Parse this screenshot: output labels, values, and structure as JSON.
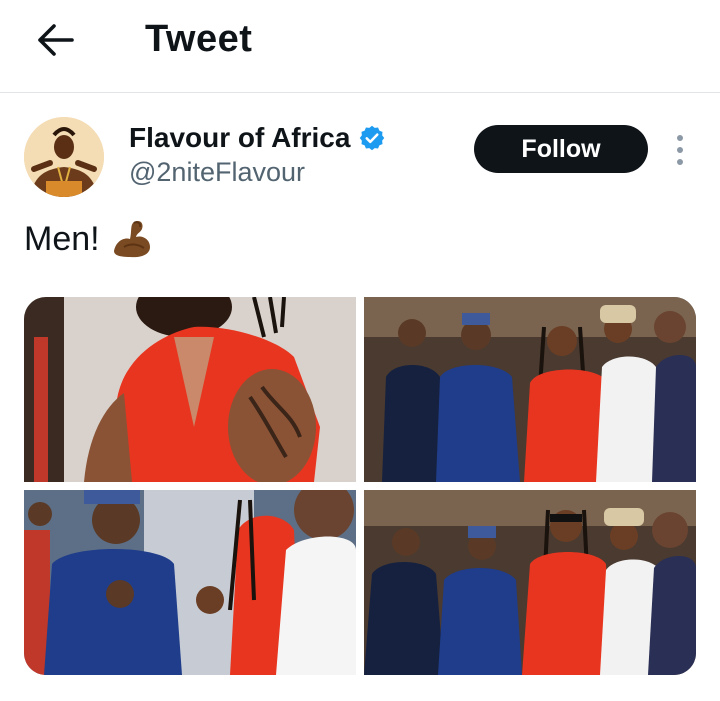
{
  "header": {
    "title": "Tweet",
    "back_icon": "arrow-left-icon"
  },
  "author": {
    "name": "Flavour of Africa",
    "handle": "@2niteFlavour",
    "verified": true,
    "verified_color": "#1d9bf0",
    "follow_label": "Follow"
  },
  "tweet": {
    "text": "Men!",
    "emoji": "flexed-biceps-dark-skin-tone"
  },
  "media": {
    "photos": [
      {
        "description": "close-up of man in red sleeveless jacket with tattooed arm"
      },
      {
        "description": "group of men in traditional attire and man in red outfit"
      },
      {
        "description": "man in blue attire talking with man in red and man in white"
      },
      {
        "description": "group of men posing, man in red outfit with sunglasses"
      }
    ]
  },
  "colors": {
    "text": "#0f1419",
    "secondary": "#536471",
    "follow_bg": "#0f1419",
    "divider": "#e1e5e8"
  }
}
